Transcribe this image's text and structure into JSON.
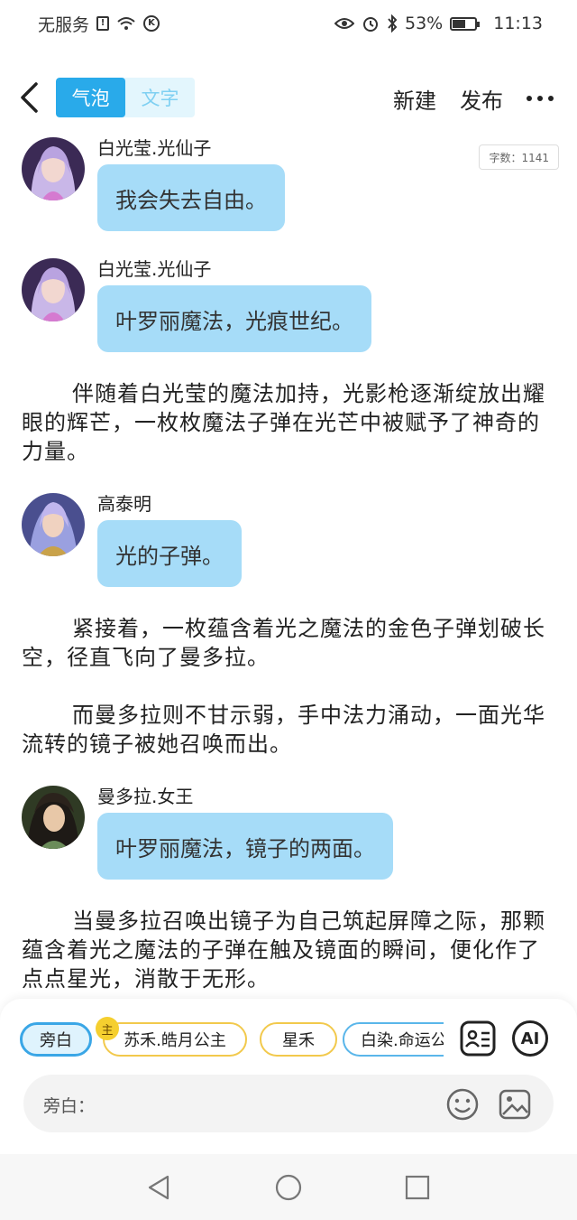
{
  "status_bar": {
    "carrier": "无服务",
    "battery": "53%",
    "time": "11:13",
    "icons": [
      "sim-alert-icon",
      "wifi-icon",
      "k-app-icon",
      "eye-icon",
      "alarm-icon",
      "bluetooth-icon",
      "battery-icon"
    ]
  },
  "header": {
    "tabs": [
      {
        "label": "气泡",
        "active": true
      },
      {
        "label": "文字",
        "active": false
      }
    ],
    "new_label": "新建",
    "publish_label": "发布",
    "icons": [
      "back-icon",
      "more-icon"
    ]
  },
  "content": {
    "word_count": "字数：1141",
    "messages": [
      {
        "speaker": "白光莹.光仙子",
        "text": "我会失去自由。",
        "avatar_color": "#7a4f9e"
      },
      {
        "speaker": "白光莹.光仙子",
        "text": "叶罗丽魔法，光痕世纪。",
        "avatar_color": "#7a4f9e"
      },
      {
        "speaker": "高泰明",
        "text": "光的子弹。",
        "avatar_color": "#5a5fb0"
      },
      {
        "speaker": "曼多拉.女王",
        "text": "叶罗丽魔法，镜子的两面。",
        "avatar_color": "#3f4a2f"
      }
    ],
    "narrations": [
      "伴随着白光莹的魔法加持，光影枪逐渐绽放出耀眼的辉芒，一枚枚魔法子弹在光芒中被赋予了神奇的力量。",
      "紧接着，一枚蕴含着光之魔法的金色子弹划破长空，径直飞向了曼多拉。",
      "而曼多拉则不甘示弱，手中法力涌动，一面光华流转的镜子被她召唤而出。",
      "当曼多拉召唤出镜子为自己筑起屏障之际，那颗蕴含着光之魔法的子弹在触及镜面的瞬间，便化作了点点星光，消散于无形。"
    ]
  },
  "composer": {
    "chips": [
      "旁白",
      "苏禾.皓月公主",
      "星禾",
      "白染.命运公"
    ],
    "owner_badge": "主",
    "ai_label": "AI",
    "input_label": "旁白：",
    "icons": [
      "character-card-icon",
      "ai-icon",
      "emoji-icon",
      "image-icon"
    ]
  },
  "navbar": {
    "icons": [
      "nav-back-icon",
      "nav-home-icon",
      "nav-recents-icon"
    ]
  },
  "colors": {
    "accent": "#29aaea",
    "bubble": "#a6dcf8",
    "chip_yellow": "#f2c94c"
  }
}
